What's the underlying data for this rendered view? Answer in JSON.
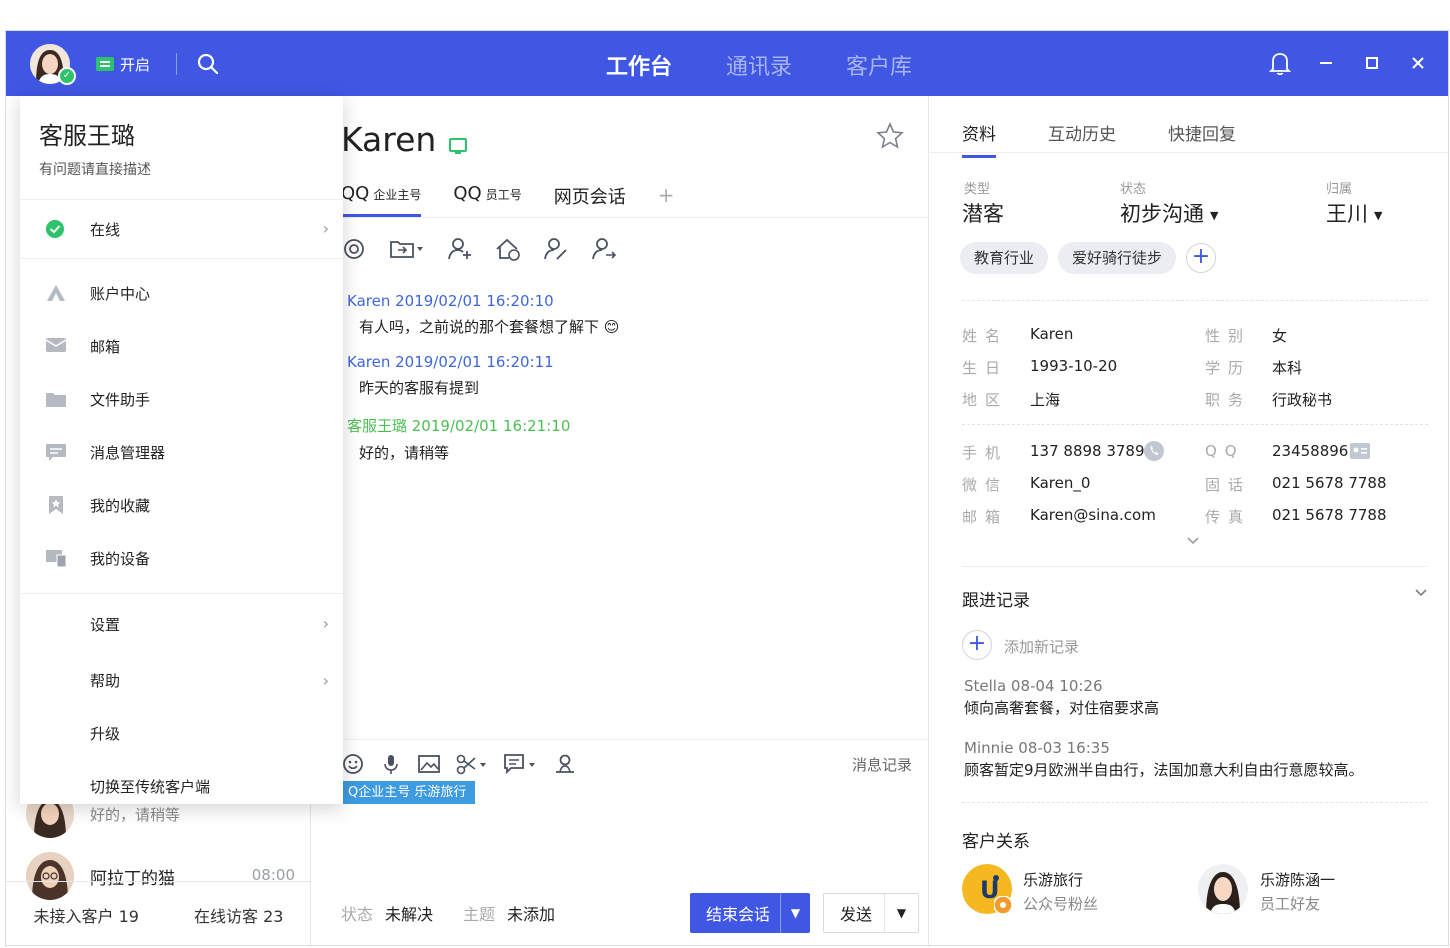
{
  "topbar": {
    "open_label": "开启",
    "nav": [
      "工作台",
      "通讯录",
      "客户库"
    ],
    "active_nav": 0
  },
  "dropdown": {
    "title": "客服王璐",
    "subtitle": "有问题请直接描述",
    "status_label": "在线",
    "items": [
      "账户中心",
      "邮箱",
      "文件助手",
      "消息管理器",
      "我的收藏",
      "我的设备"
    ],
    "settings": [
      "设置",
      "帮助",
      "升级",
      "切换至传统客户端"
    ]
  },
  "left": {
    "partial_preview": "好的，请稍等",
    "conversation": {
      "name": "阿拉丁的猫",
      "time": "08:00"
    },
    "footer": {
      "unassigned": "未接入客户 19",
      "visitors": "在线访客 23"
    }
  },
  "chat": {
    "name": "Karen",
    "tabs": [
      {
        "main": "QQ",
        "sub": "企业主号"
      },
      {
        "main": "QQ",
        "sub": "员工号"
      },
      {
        "main": "网页会话",
        "sub": ""
      }
    ],
    "tab_plus": "+",
    "messages": [
      {
        "meta": "Karen 2019/02/01 16:20:10",
        "text": "有人吗，之前说的那个套餐想了解下 😊"
      },
      {
        "meta": "Karen 2019/02/01 16:20:11",
        "text": "昨天的客服有提到"
      },
      {
        "meta": "客服王璐 2019/02/01 16:21:10",
        "text": "好的，请稍等"
      }
    ],
    "history_label": "消息记录",
    "chip": "Q企业主号 乐游旅行",
    "footer": {
      "status_label": "状态",
      "status_value": "未解决",
      "topic_label": "主题",
      "topic_value": "未添加"
    },
    "end_label": "结束会话",
    "send_label": "发送"
  },
  "right": {
    "tabs": [
      "资料",
      "互动历史",
      "快捷回复"
    ],
    "type_label": "类型",
    "type_value": "潜客",
    "status_label": "状态",
    "status_value": "初步沟通",
    "owner_label": "归属",
    "owner_value": "王川",
    "tags": [
      "教育行业",
      "爱好骑行徒步"
    ],
    "info": [
      {
        "k": "姓名",
        "v": "Karen"
      },
      {
        "k": "性别",
        "v": "女"
      },
      {
        "k": "生日",
        "v": "1993-10-20"
      },
      {
        "k": "学历",
        "v": "本科"
      },
      {
        "k": "地区",
        "v": "上海"
      },
      {
        "k": "职务",
        "v": "行政秘书"
      },
      {
        "k": "手机",
        "v": "137 8898 3789"
      },
      {
        "k": "QQ",
        "v": "23458896"
      },
      {
        "k": "微信",
        "v": "Karen_0"
      },
      {
        "k": "固话",
        "v": "021 5678 7788"
      },
      {
        "k": "邮箱",
        "v": "Karen@sina.com"
      },
      {
        "k": "传真",
        "v": "021 5678 7788"
      }
    ],
    "follow_title": "跟进记录",
    "add_record": "添加新记录",
    "records": [
      {
        "meta": "Stella  08-04  10:26",
        "text": "倾向高奢套餐，对住宿要求高"
      },
      {
        "meta": "Minnie  08-03  16:35",
        "text": "顾客暂定9月欧洲半自由行，法国加意大利自由行意愿较高。"
      }
    ],
    "relations_title": "客户关系",
    "relations": [
      {
        "name": "乐游旅行",
        "sub": "公众号粉丝"
      },
      {
        "name": "乐游陈涵一",
        "sub": "员工好友"
      }
    ]
  },
  "colors": {
    "brand": "#3f57e3",
    "online": "#2dc26b",
    "customer_meta": "#3f67d9",
    "agent_meta": "#4cbf52"
  }
}
